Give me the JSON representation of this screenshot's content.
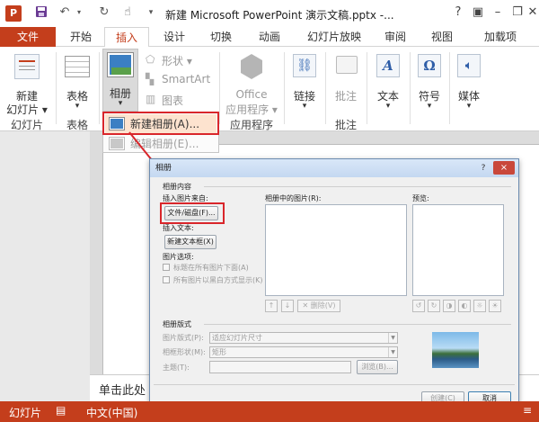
{
  "titlebar": {
    "app_logo": "P",
    "doc_title": "新建 Microsoft PowerPoint 演示文稿.pptx -...",
    "help_label": "?",
    "quick_access": [
      "save-icon",
      "undo-icon",
      "redo-icon",
      "touch-mode-icon",
      "customize-icon"
    ]
  },
  "tabs": [
    "文件",
    "开始",
    "插入",
    "设计",
    "切换",
    "动画",
    "幻灯片放映",
    "审阅",
    "视图",
    "加载项"
  ],
  "ribbon": {
    "new_slide": [
      "新建",
      "幻灯片 ▾"
    ],
    "table": [
      "表格",
      "▾"
    ],
    "album": [
      "相册",
      "▾"
    ],
    "shapes": "形状 ▾",
    "smartart": "SmartArt",
    "chart": "图表",
    "office_apps": [
      "Office",
      "应用程序 ▾"
    ],
    "links": [
      "链接",
      "▾"
    ],
    "comment": "批注",
    "text": [
      "文本",
      "▾"
    ],
    "symbols": [
      "符号",
      "▾"
    ],
    "media": [
      "媒体",
      "▾"
    ],
    "groups": [
      "幻灯片",
      "表格",
      "应用程序",
      "批注"
    ]
  },
  "dropdown": {
    "items": [
      "新建相册(A)...",
      "编辑相册(E)..."
    ]
  },
  "dialog": {
    "title": "相册",
    "help": "?",
    "close": "×",
    "section_content": "相册内容",
    "insert_from": "插入图片来自:",
    "file_disk_button": "文件/磁盘(F)...",
    "insert_text": "插入文本:",
    "new_textbox_button": "新建文本框(X)",
    "picture_options": "图片选项:",
    "caption_below": "标题在所有图片下面(A)",
    "all_black_white": "所有图片以黑白方式显示(K)",
    "pictures_in_album": "相册中的图片(R):",
    "preview": "预览:",
    "move_up": "↑",
    "move_down": "↓",
    "delete": "删除(V)",
    "section_layout": "相册版式",
    "picture_layout_label": "图片版式(P):",
    "picture_layout_value": "适应幻灯片尺寸",
    "frame_shape_label": "相框形状(M):",
    "frame_shape_value": "矩形",
    "theme_label": "主题(T):",
    "browse_button": "浏览(B)...",
    "create_button": "创建(C)",
    "cancel_button": "取消"
  },
  "notes_text": "单击此处",
  "status": {
    "slide": "幻灯片",
    "language": "中文(中国)"
  },
  "colors": {
    "accent": "#c43e1c",
    "highlight": "#d9262b"
  }
}
